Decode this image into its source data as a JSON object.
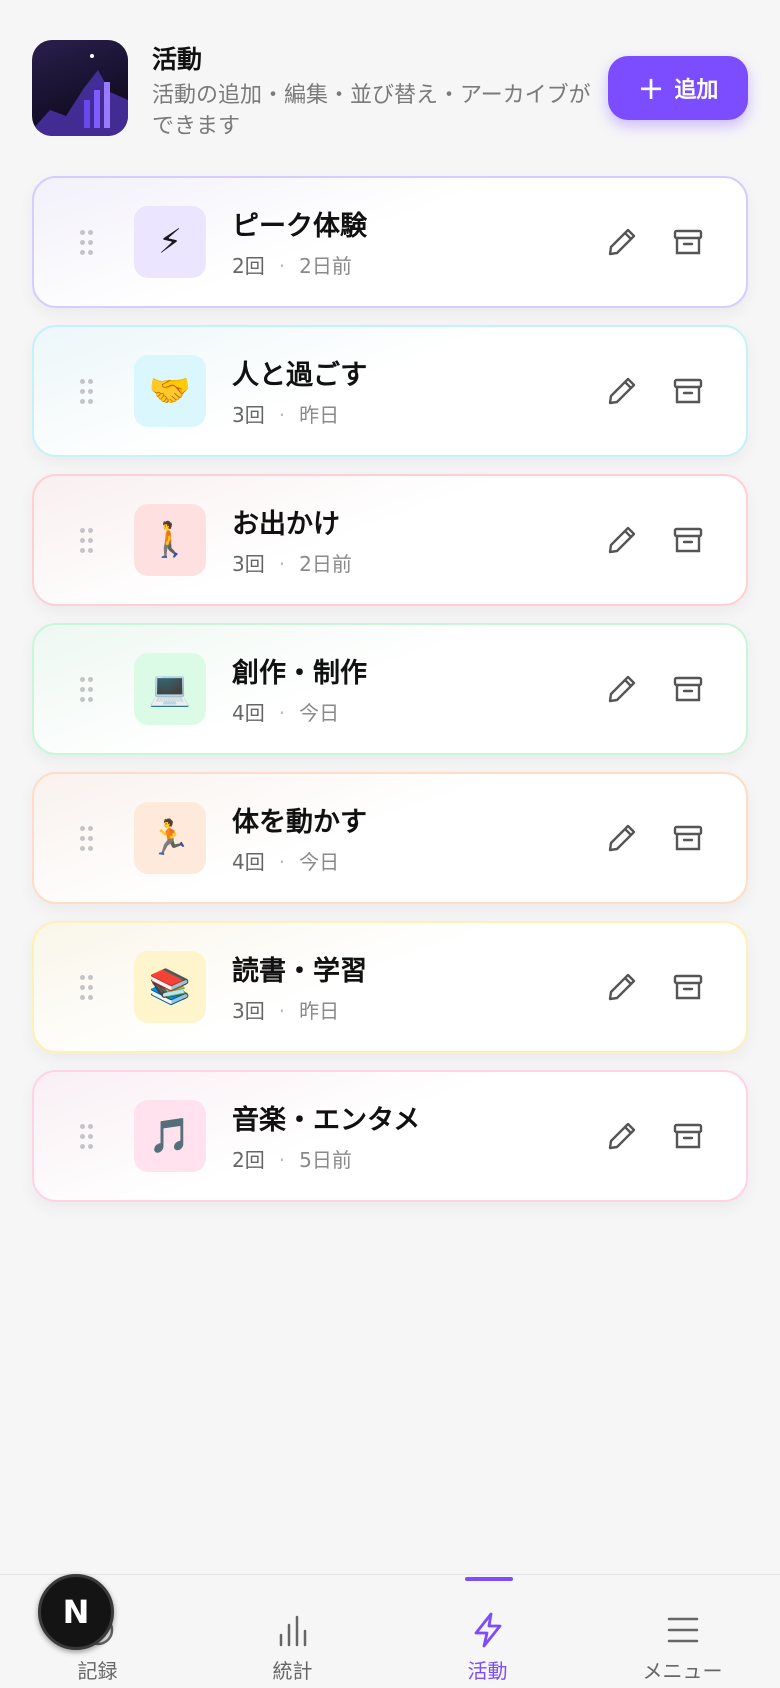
{
  "header": {
    "title": "活動",
    "subtitle": "活動の追加・編集・並び替え・アーカイブができます",
    "add_label": "追加"
  },
  "activities": [
    {
      "name": "ピーク体験",
      "count": "2回",
      "last": "2日前",
      "emoji": "⚡",
      "accent": "#d6ccff",
      "tint": "#ebe5ff"
    },
    {
      "name": "人と過ごす",
      "count": "3回",
      "last": "昨日",
      "emoji": "🤝",
      "accent": "#c6f1fb",
      "tint": "#d9f7fd"
    },
    {
      "name": "お出かけ",
      "count": "3回",
      "last": "2日前",
      "emoji": "🚶",
      "accent": "#ffd0d3",
      "tint": "#ffe0e1"
    },
    {
      "name": "創作・制作",
      "count": "4回",
      "last": "今日",
      "emoji": "💻",
      "accent": "#c9f6d9",
      "tint": "#dcfbe6"
    },
    {
      "name": "体を動かす",
      "count": "4回",
      "last": "今日",
      "emoji": "🏃",
      "accent": "#ffdcc6",
      "tint": "#ffe9db"
    },
    {
      "name": "読書・学習",
      "count": "3回",
      "last": "昨日",
      "emoji": "📚",
      "accent": "#fff0b8",
      "tint": "#fff5cc"
    },
    {
      "name": "音楽・エンタメ",
      "count": "2回",
      "last": "5日前",
      "emoji": "🎵",
      "accent": "#ffd3e6",
      "tint": "#ffe2ee"
    }
  ],
  "nav": {
    "items": [
      "記録",
      "統計",
      "活動",
      "メニュー"
    ],
    "active": "活動"
  },
  "dev_badge": "N",
  "colors": {
    "accent": "#7c4dff",
    "background": "#f6f6f7"
  }
}
